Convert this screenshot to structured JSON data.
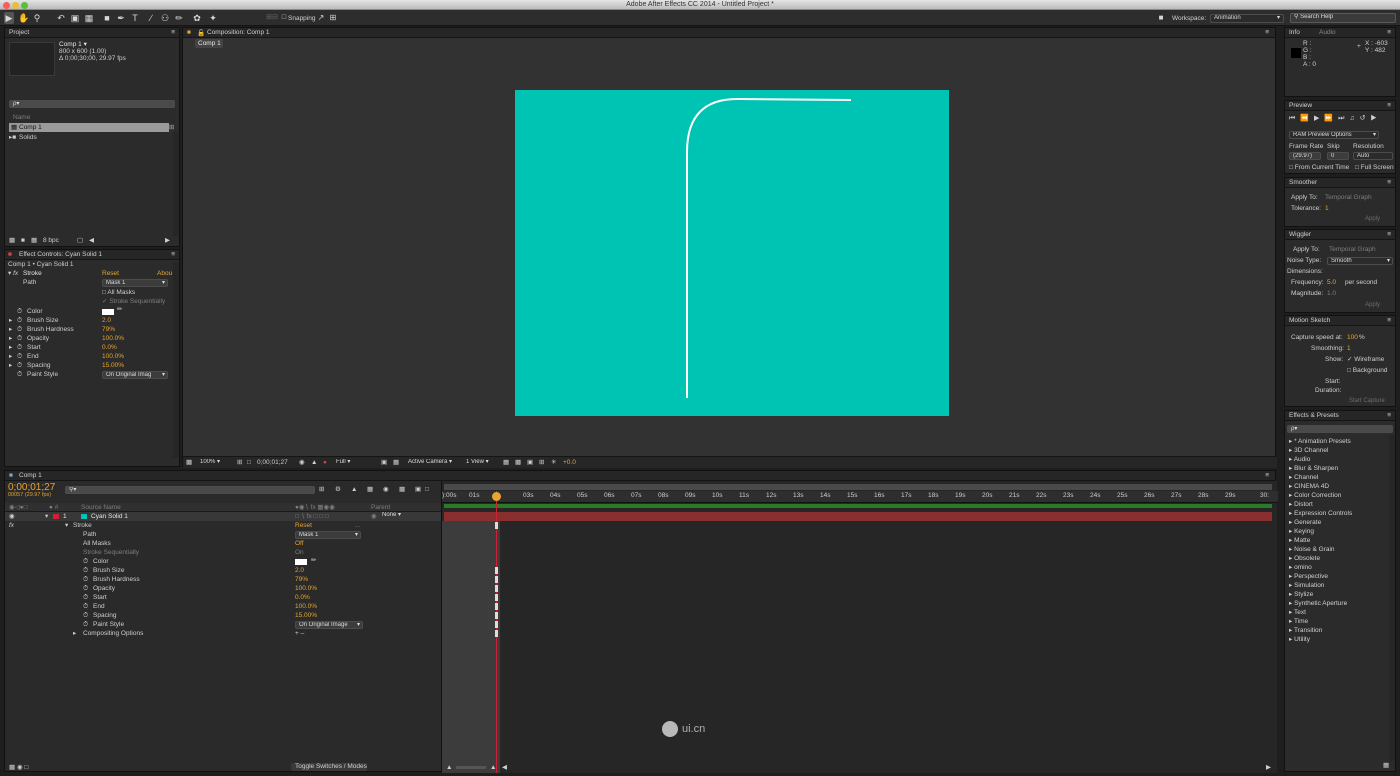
{
  "app": {
    "window_title": "Adobe After Effects CC 2014 - Untitled Project *"
  },
  "toolbar": {
    "snapping_label": "Snapping",
    "workspace_label": "Workspace:",
    "workspace_value": "Animation",
    "search_placeholder": "Search Help"
  },
  "project_panel": {
    "tab": "Project",
    "comp_name": "Comp 1 ▾",
    "comp_size": "800 x 600 (1.00)",
    "comp_duration": "Δ 0;00;30;00, 29.97 fps",
    "search_placeholder": "ρ▾",
    "col_name": "Name",
    "items": [
      "Comp 1",
      "Solids"
    ],
    "bpc": "8 bpc"
  },
  "effect_controls": {
    "tab": "Effect Controls: Cyan Solid 1",
    "layer_path": "Comp 1 • Cyan Solid 1",
    "effect_name": "Stroke",
    "reset": "Reset",
    "about": "Abou",
    "path_label": "Path",
    "path_value": "Mask 1",
    "all_masks": "All Masks",
    "stroke_sequentially": "Stroke Sequentially",
    "props": [
      {
        "name": "Color",
        "value": ""
      },
      {
        "name": "Brush Size",
        "value": "2.0"
      },
      {
        "name": "Brush Hardness",
        "value": "79%"
      },
      {
        "name": "Opacity",
        "value": "100.0%"
      },
      {
        "name": "Start",
        "value": "0.0%"
      },
      {
        "name": "End",
        "value": "100.0%"
      },
      {
        "name": "Spacing",
        "value": "15.00%"
      },
      {
        "name": "Paint Style",
        "value": "On Original Imag"
      }
    ]
  },
  "composition": {
    "tab": "Composition: Comp 1",
    "subtab": "Comp 1",
    "zoom": "100%",
    "timecode": "0;00;01;27",
    "resolution": "Full",
    "camera": "Active Camera",
    "view": "1 View",
    "exposure": "+0.0",
    "solid_color": "#00c4b3"
  },
  "timeline": {
    "tab": "Comp 1",
    "timecode": "0;00;01;27",
    "frame_info": "00057 (29.97 fps)",
    "col_source": "Source Name",
    "col_parent": "Parent",
    "layer_num": "1",
    "layer_name": "Cyan Solid 1",
    "parent_value": "None",
    "effect_name": "Stroke",
    "reset": "Reset",
    "props": [
      {
        "name": "Path",
        "value": "Mask 1"
      },
      {
        "name": "All Masks",
        "value": "Off"
      },
      {
        "name": "Stroke Sequentially",
        "value": "On"
      },
      {
        "name": "Color",
        "value": ""
      },
      {
        "name": "Brush Size",
        "value": "2.0"
      },
      {
        "name": "Brush Hardness",
        "value": "79%"
      },
      {
        "name": "Opacity",
        "value": "100.0%"
      },
      {
        "name": "Start",
        "value": "0.0%"
      },
      {
        "name": "End",
        "value": "100.0%"
      },
      {
        "name": "Spacing",
        "value": "15.00%"
      },
      {
        "name": "Paint Style",
        "value": "On Original Image"
      }
    ],
    "compositing": "Compositing Options",
    "toggle": "Toggle Switches / Modes",
    "ruler": [
      "):00s",
      "01s",
      "",
      "03s",
      "04s",
      "05s",
      "06s",
      "07s",
      "08s",
      "09s",
      "10s",
      "11s",
      "12s",
      "13s",
      "14s",
      "15s",
      "16s",
      "17s",
      "18s",
      "19s",
      "20s",
      "21s",
      "22s",
      "23s",
      "24s",
      "25s",
      "26s",
      "27s",
      "28s",
      "29s",
      "30:"
    ],
    "watermark": "ui.cn"
  },
  "info_panel": {
    "tabs": [
      "Info",
      "Audio"
    ],
    "r": "R :",
    "g": "G :",
    "b": "B :",
    "a": "A : 0",
    "x": "X : -603",
    "y": "Y : 482"
  },
  "preview_panel": {
    "tab": "Preview",
    "ram_options": "RAM Preview Options",
    "frame_rate": "Frame Rate",
    "skip": "Skip",
    "resolution": "Resolution",
    "fr_value": "(29.97)",
    "skip_value": "0",
    "res_value": "Auto",
    "from_current": "From Current Time",
    "full_screen": "Full Screen"
  },
  "smoother_panel": {
    "tab": "Smoother",
    "apply_to": "Apply To:",
    "apply_to_value": "Temporal Graph",
    "tolerance": "Tolerance:",
    "tolerance_value": "1",
    "apply": "Apply"
  },
  "wiggler_panel": {
    "tab": "Wiggler",
    "apply_to": "Apply To:",
    "apply_to_value": "Temporal Graph",
    "noise_type": "Noise Type:",
    "noise_value": "Smooth",
    "dimensions": "Dimensions:",
    "frequency": "Frequency:",
    "frequency_value": "5.0",
    "per_second": "per second",
    "magnitude": "Magnitude:",
    "magnitude_value": "1.0",
    "apply": "Apply"
  },
  "motion_sketch_panel": {
    "tab": "Motion Sketch",
    "capture_speed": "Capture speed at:",
    "capture_value": "100",
    "capture_unit": "%",
    "smoothing": "Smoothing:",
    "smoothing_value": "1",
    "show": "Show:",
    "wireframe": "Wireframe",
    "background": "Background",
    "start": "Start:",
    "duration": "Duration:",
    "start_capture": "Start Capture"
  },
  "effects_presets": {
    "tab": "Effects & Presets",
    "search_placeholder": "ρ▾",
    "items": [
      "* Animation Presets",
      "3D Channel",
      "Audio",
      "Blur & Sharpen",
      "Channel",
      "CINEMA 4D",
      "Color Correction",
      "Distort",
      "Expression Controls",
      "Generate",
      "Keying",
      "Matte",
      "Noise & Grain",
      "Obsolete",
      "omino",
      "Perspective",
      "Simulation",
      "Stylize",
      "Synthetic Aperture",
      "Text",
      "Time",
      "Transition",
      "Utility"
    ]
  }
}
